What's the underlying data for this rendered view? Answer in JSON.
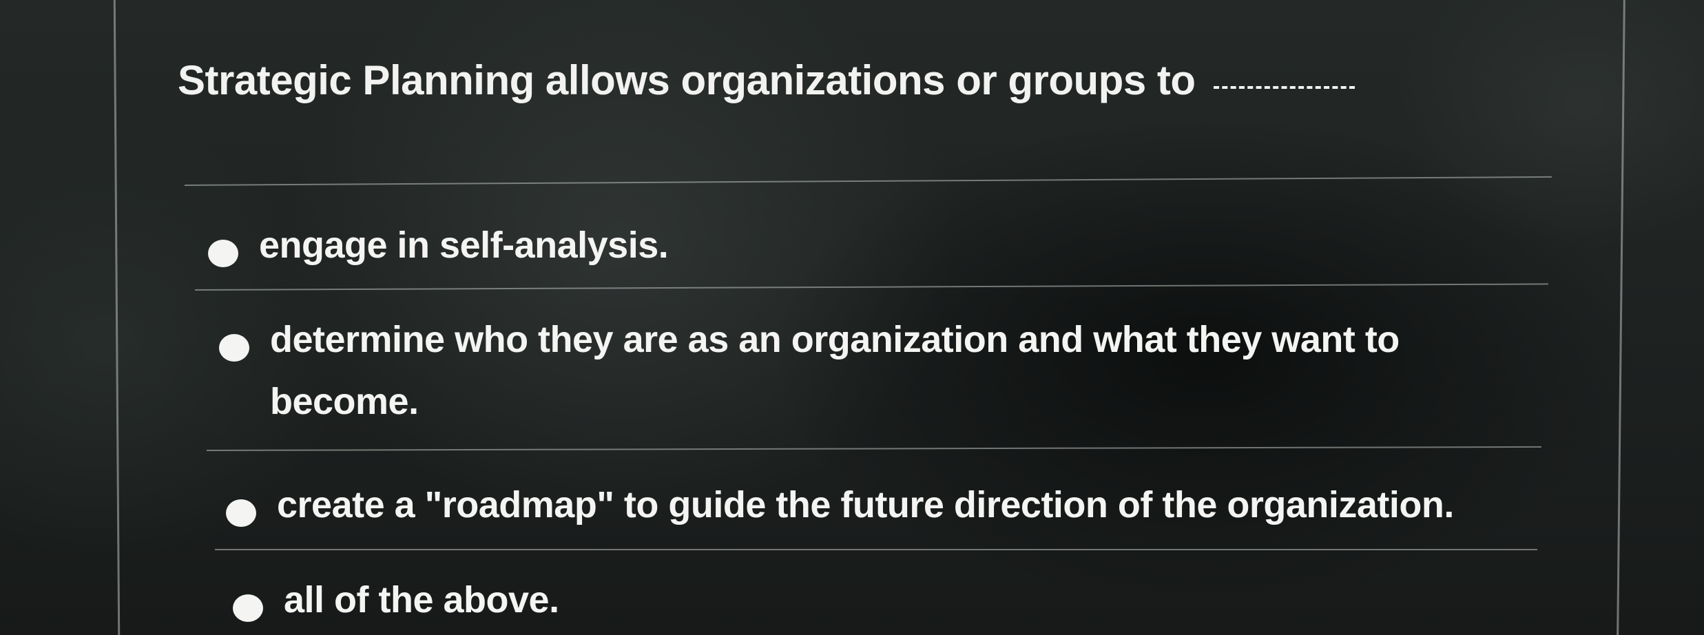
{
  "question": {
    "text": "Strategic Planning allows organizations or groups to"
  },
  "options": [
    {
      "label": "engage in self-analysis."
    },
    {
      "label": "determine who they are as an organization and what they want to become."
    },
    {
      "label": "create a \"roadmap\" to guide the future direction of the organization."
    },
    {
      "label": "all of the above."
    }
  ],
  "colors": {
    "text": "#f2f3f1",
    "background": "#1b1f1e",
    "rule": "#bec4c0"
  }
}
